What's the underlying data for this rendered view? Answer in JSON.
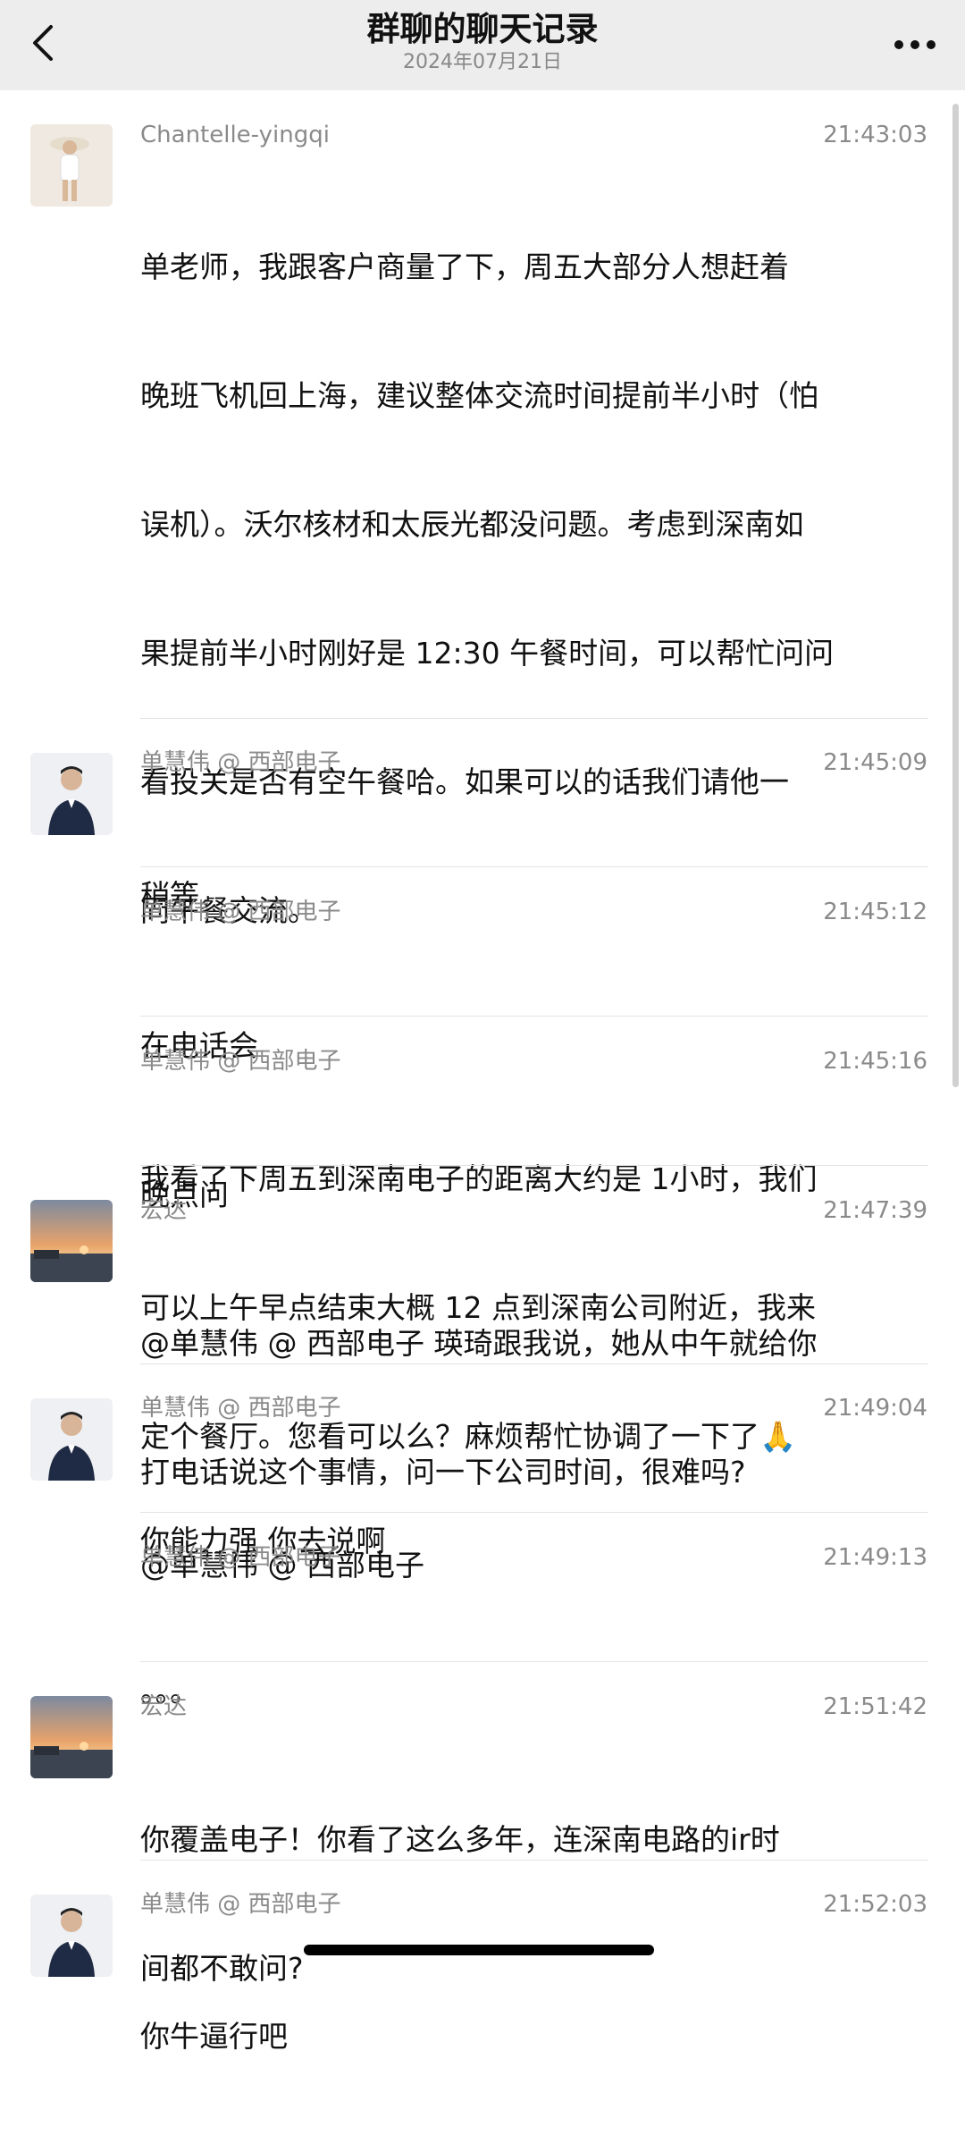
{
  "header": {
    "title": "群聊的聊天记录",
    "date": "2024年07月21日"
  },
  "messages": [
    {
      "sender": "Chantelle-yingqi",
      "time": "21:43:03",
      "avatar": "avatar-woman-hat",
      "lines": [
        "单老师，我跟客户商量了下，周五大部分人想赶着",
        "晚班飞机回上海，建议整体交流时间提前半小时（怕",
        "误机）。沃尔核材和太辰光都没问题。考虑到深南如",
        "果提前半小时刚好是 12:30 午餐时间，可以帮忙问问",
        "看投关是否有空午餐哈。如果可以的话我们请他一",
        "同午餐交流。",
        "",
        "我看了下周五到深南电子的距离大约是 1小时，我们",
        "可以上午早点结束大概 12 点到深南公司附近，我来",
        "定个餐厅。您看可以么？麻烦帮忙协调了一下了🙏",
        "@单慧伟 @ 西部电子"
      ]
    },
    {
      "sender": "单慧伟 @ 西部电子",
      "time": "21:45:09",
      "avatar": "avatar-man-suit",
      "lines": [
        "稍等"
      ]
    },
    {
      "sender": "单慧伟 @ 西部电子",
      "time": "21:45:12",
      "avatar": "",
      "lines": [
        "在电话会"
      ]
    },
    {
      "sender": "单慧伟 @ 西部电子",
      "time": "21:45:16",
      "avatar": "",
      "lines": [
        "晚点问"
      ]
    },
    {
      "sender": "宏达",
      "time": "21:47:39",
      "avatar": "avatar-sunset",
      "lines": [
        "@单慧伟 @ 西部电子 瑛琦跟我说，她从中午就给你",
        "打电话说这个事情，问一下公司时间，很难吗?"
      ]
    },
    {
      "sender": "单慧伟 @ 西部电子",
      "time": "21:49:04",
      "avatar": "avatar-man-suit",
      "lines": [
        "你能力强 你去说啊"
      ]
    },
    {
      "sender": "单慧伟 @ 西部电子",
      "time": "21:49:13",
      "avatar": "",
      "lines": [
        "。。。"
      ]
    },
    {
      "sender": "宏达",
      "time": "21:51:42",
      "avatar": "avatar-sunset",
      "lines": [
        "你覆盖电子！你看了这么多年，连深南电路的ir时",
        "间都不敢问?"
      ]
    },
    {
      "sender": "单慧伟 @ 西部电子",
      "time": "21:52:03",
      "avatar": "avatar-man-suit",
      "lines": [
        "你牛逼行吧"
      ]
    }
  ]
}
